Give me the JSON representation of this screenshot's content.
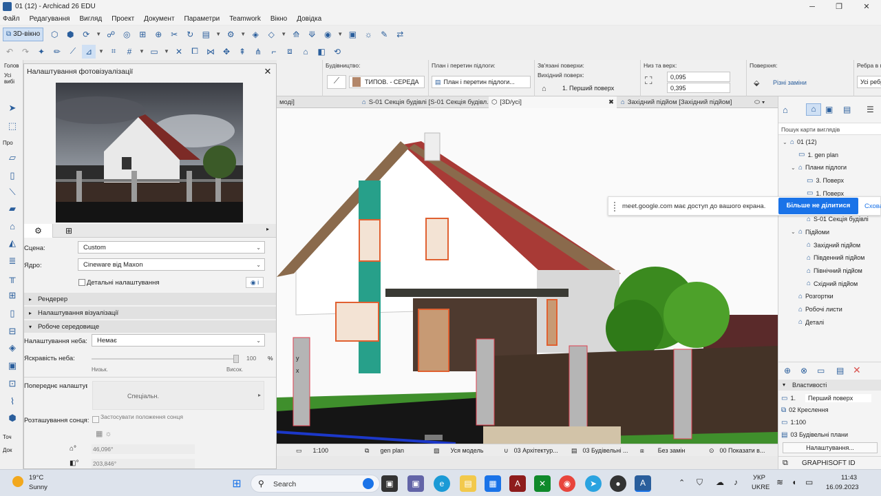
{
  "window": {
    "title": "01 (12) - Archicad 26 EDU",
    "minimize": "─",
    "maximize": "❐",
    "close": "✕"
  },
  "menu": [
    "Файл",
    "Редагування",
    "Вигляд",
    "Проект",
    "Документ",
    "Параметри",
    "Teamwork",
    "Вікно",
    "Довідка"
  ],
  "toolbar": {
    "view3d_label": "3D-вікно"
  },
  "infobox": {
    "left_label": "Голов",
    "left_value": "Усі вибі",
    "building_label": "Будівництво:",
    "composite_value": "ТИПОВ. - СЕРЕДА",
    "plan_label": "План і перетин підлоги:",
    "plan_value": "План і перетин підлоги...",
    "linked_label": "Зв'язані поверхи:",
    "home_story_label": "Вихідний поверх:",
    "home_story_value": "1. Перший поверх",
    "bottom_top_label": "Низ та верх:",
    "top_value": "0,095",
    "bottom_value": "0,395",
    "surface_label": "Поверхня:",
    "surface_value": "Різні заміни",
    "edge_label": "Ребра в моду",
    "edge_value": "Усі ребр"
  },
  "tabs": [
    {
      "label": "моді]"
    },
    {
      "label": "S-01 Секція будівлі [S-01 Секція будівл..."
    },
    {
      "label": "[3D/усі]"
    },
    {
      "label": "Західний підйом [Західний підйом]"
    }
  ],
  "tab_close": "✖",
  "dialog": {
    "title": "Налаштування фотовізуалізації",
    "close": "✕",
    "scene_label": "Сцена:",
    "scene_value": "Custom",
    "engine_label": "Ядро:",
    "engine_value": "Cineware від Maxon",
    "detailed_label": "Детальні налаштування",
    "sections": [
      "Рендерер",
      "Налаштування візуалізації",
      "Робоче середовище"
    ],
    "sky_label": "Налаштування неба:",
    "sky_value": "Немає",
    "sky_brightness_label": "Яскравість неба:",
    "sky_brightness_value": "100",
    "sky_brightness_fraction": 1.0,
    "percent": "%",
    "low_label": "Низьк.",
    "high_label": "Висок.",
    "preset_label": "Попереднє налаштува",
    "preset_value": "Спеціальн.",
    "sun_label": "Розташування сонця:",
    "sun_checkbox_label": "Застосувати положення сонця Archicad",
    "azimuth_value": "46,096°",
    "altitude_value": "203,846°"
  },
  "left_palette": {
    "section1": "Про",
    "section2": "Точ",
    "section3": "Док"
  },
  "statusbar": {
    "scale": "1:100",
    "layout": "gen plan",
    "model": "Уся модель",
    "layers": "03 Архітектур...",
    "pen": "03 Будівельні ...",
    "override": "Без замін",
    "renovation": "00 Показати в..."
  },
  "viewport_markers": {
    "axis_y": "y",
    "axis_x": "x"
  },
  "navigator": {
    "search_placeholder": "Пошук карти виглядів",
    "items": [
      {
        "label": "01 (12)",
        "level": 0,
        "icon": "project-icon",
        "expander": "⌄"
      },
      {
        "label": "1. gen plan",
        "level": 1,
        "icon": "story-icon",
        "expander": ""
      },
      {
        "label": "Плани підлоги",
        "level": 1,
        "icon": "folder-icon",
        "expander": "⌄"
      },
      {
        "label": "3. Поверх",
        "level": 2,
        "icon": "story-icon",
        "expander": ""
      },
      {
        "label": "1. Поверх",
        "level": 2,
        "icon": "story-icon",
        "expander": ""
      },
      {
        "label": "Перетини",
        "level": 1,
        "icon": "folder-icon",
        "expander": "⌄"
      },
      {
        "label": "S-01 Секція будівлі",
        "level": 2,
        "icon": "section-icon",
        "expander": ""
      },
      {
        "label": "Підйоми",
        "level": 1,
        "icon": "folder-icon",
        "expander": "⌄"
      },
      {
        "label": "Західний підйом",
        "level": 2,
        "icon": "elevation-icon",
        "expander": ""
      },
      {
        "label": "Південний підйом",
        "level": 2,
        "icon": "elevation-icon",
        "expander": ""
      },
      {
        "label": "Північний підйом",
        "level": 2,
        "icon": "elevation-icon",
        "expander": ""
      },
      {
        "label": "Східний підйом",
        "level": 2,
        "icon": "elevation-icon",
        "expander": ""
      },
      {
        "label": "Розгортки",
        "level": 1,
        "icon": "folder-icon",
        "expander": ""
      },
      {
        "label": "Робочі листи",
        "level": 1,
        "icon": "folder-icon",
        "expander": ""
      },
      {
        "label": "Деталі",
        "level": 1,
        "icon": "folder-icon",
        "expander": ""
      }
    ]
  },
  "properties": {
    "header": "Властивості",
    "number": "1.",
    "story": "Перший поверх",
    "drawing": "02 Креслення",
    "scale": "1:100",
    "pen_set": "03 Будівельні плани",
    "settings_button": "Налаштування...",
    "brand": "GRAPHISOFT ID"
  },
  "sharebar": {
    "message": "meet.google.com має доступ до вашого екрана.",
    "stop_button": "Більше не ділитися",
    "hide_link": "Сховати"
  },
  "taskbar": {
    "weather_temp": "19°C",
    "weather_text": "Sunny",
    "search_label": "Search",
    "lang_top": "УКР",
    "lang_bottom": "UKRE",
    "time": "11:43",
    "date": "16.09.2023"
  },
  "colors": {
    "accent": "#2a5e9c",
    "share_button": "#1a73e8",
    "roof": "#a83a36",
    "wall": "#ffffff",
    "grass": "#3f8f2c"
  }
}
